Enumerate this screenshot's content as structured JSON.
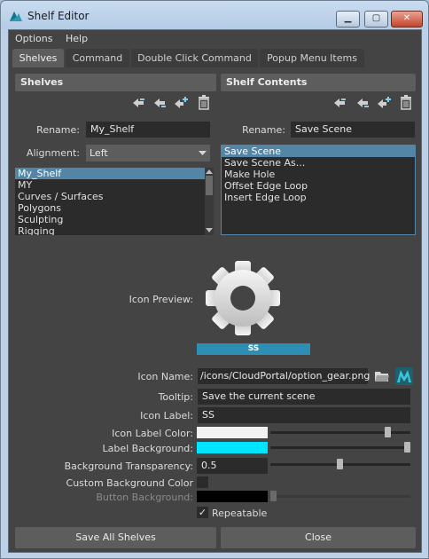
{
  "window": {
    "title": "Shelf Editor"
  },
  "menu": [
    "Options",
    "Help"
  ],
  "tabs": [
    "Shelves",
    "Command",
    "Double Click Command",
    "Popup Menu Items"
  ],
  "shelves_panel": {
    "header": "Shelves",
    "rename_label": "Rename:",
    "rename_value": "My_Shelf",
    "alignment_label": "Alignment:",
    "alignment_value": "Left",
    "items": [
      "My_Shelf",
      "MY",
      "Curves / Surfaces",
      "Polygons",
      "Sculpting",
      "Rigging"
    ],
    "selected_index": 0
  },
  "contents_panel": {
    "header": "Shelf Contents",
    "rename_label": "Rename:",
    "rename_value": "Save Scene",
    "items": [
      "Save Scene",
      "Save Scene As...",
      "Make Hole",
      "Offset Edge Loop",
      "Insert Edge Loop"
    ],
    "selected_index": 0
  },
  "details": {
    "icon_preview_label": "Icon Preview:",
    "preview_text": "SS",
    "icon_name_label": "Icon Name:",
    "icon_name_value": "/icons/CloudPortal/option_gear.png",
    "tooltip_label": "Tooltip:",
    "tooltip_value": "Save the current scene",
    "icon_label_label": "Icon Label:",
    "icon_label_value": "SS",
    "icon_label_color_label": "Icon Label Color:",
    "label_background_label": "Label Background:",
    "bg_transparency_label": "Background Transparency:",
    "bg_transparency_value": "0.5",
    "custom_bg_color_label": "Custom Background Color",
    "button_background_label": "Button Background:",
    "repeatable_label": "Repeatable",
    "repeatable_checked": "✓"
  },
  "colors": {
    "icon_label_color": "#f2f2f2",
    "label_background": "#00e5ff",
    "button_background": "#000000",
    "preview_label_bg": "#2d8fb3"
  },
  "icons": [
    "shelf-editor-app-icon",
    "move-up-icon",
    "move-down-icon",
    "add-icon",
    "trash-icon",
    "folder-icon",
    "maya-icon",
    "gear-icon",
    "checkmark-icon"
  ],
  "buttons": {
    "save_all": "Save All Shelves",
    "close": "Close"
  }
}
